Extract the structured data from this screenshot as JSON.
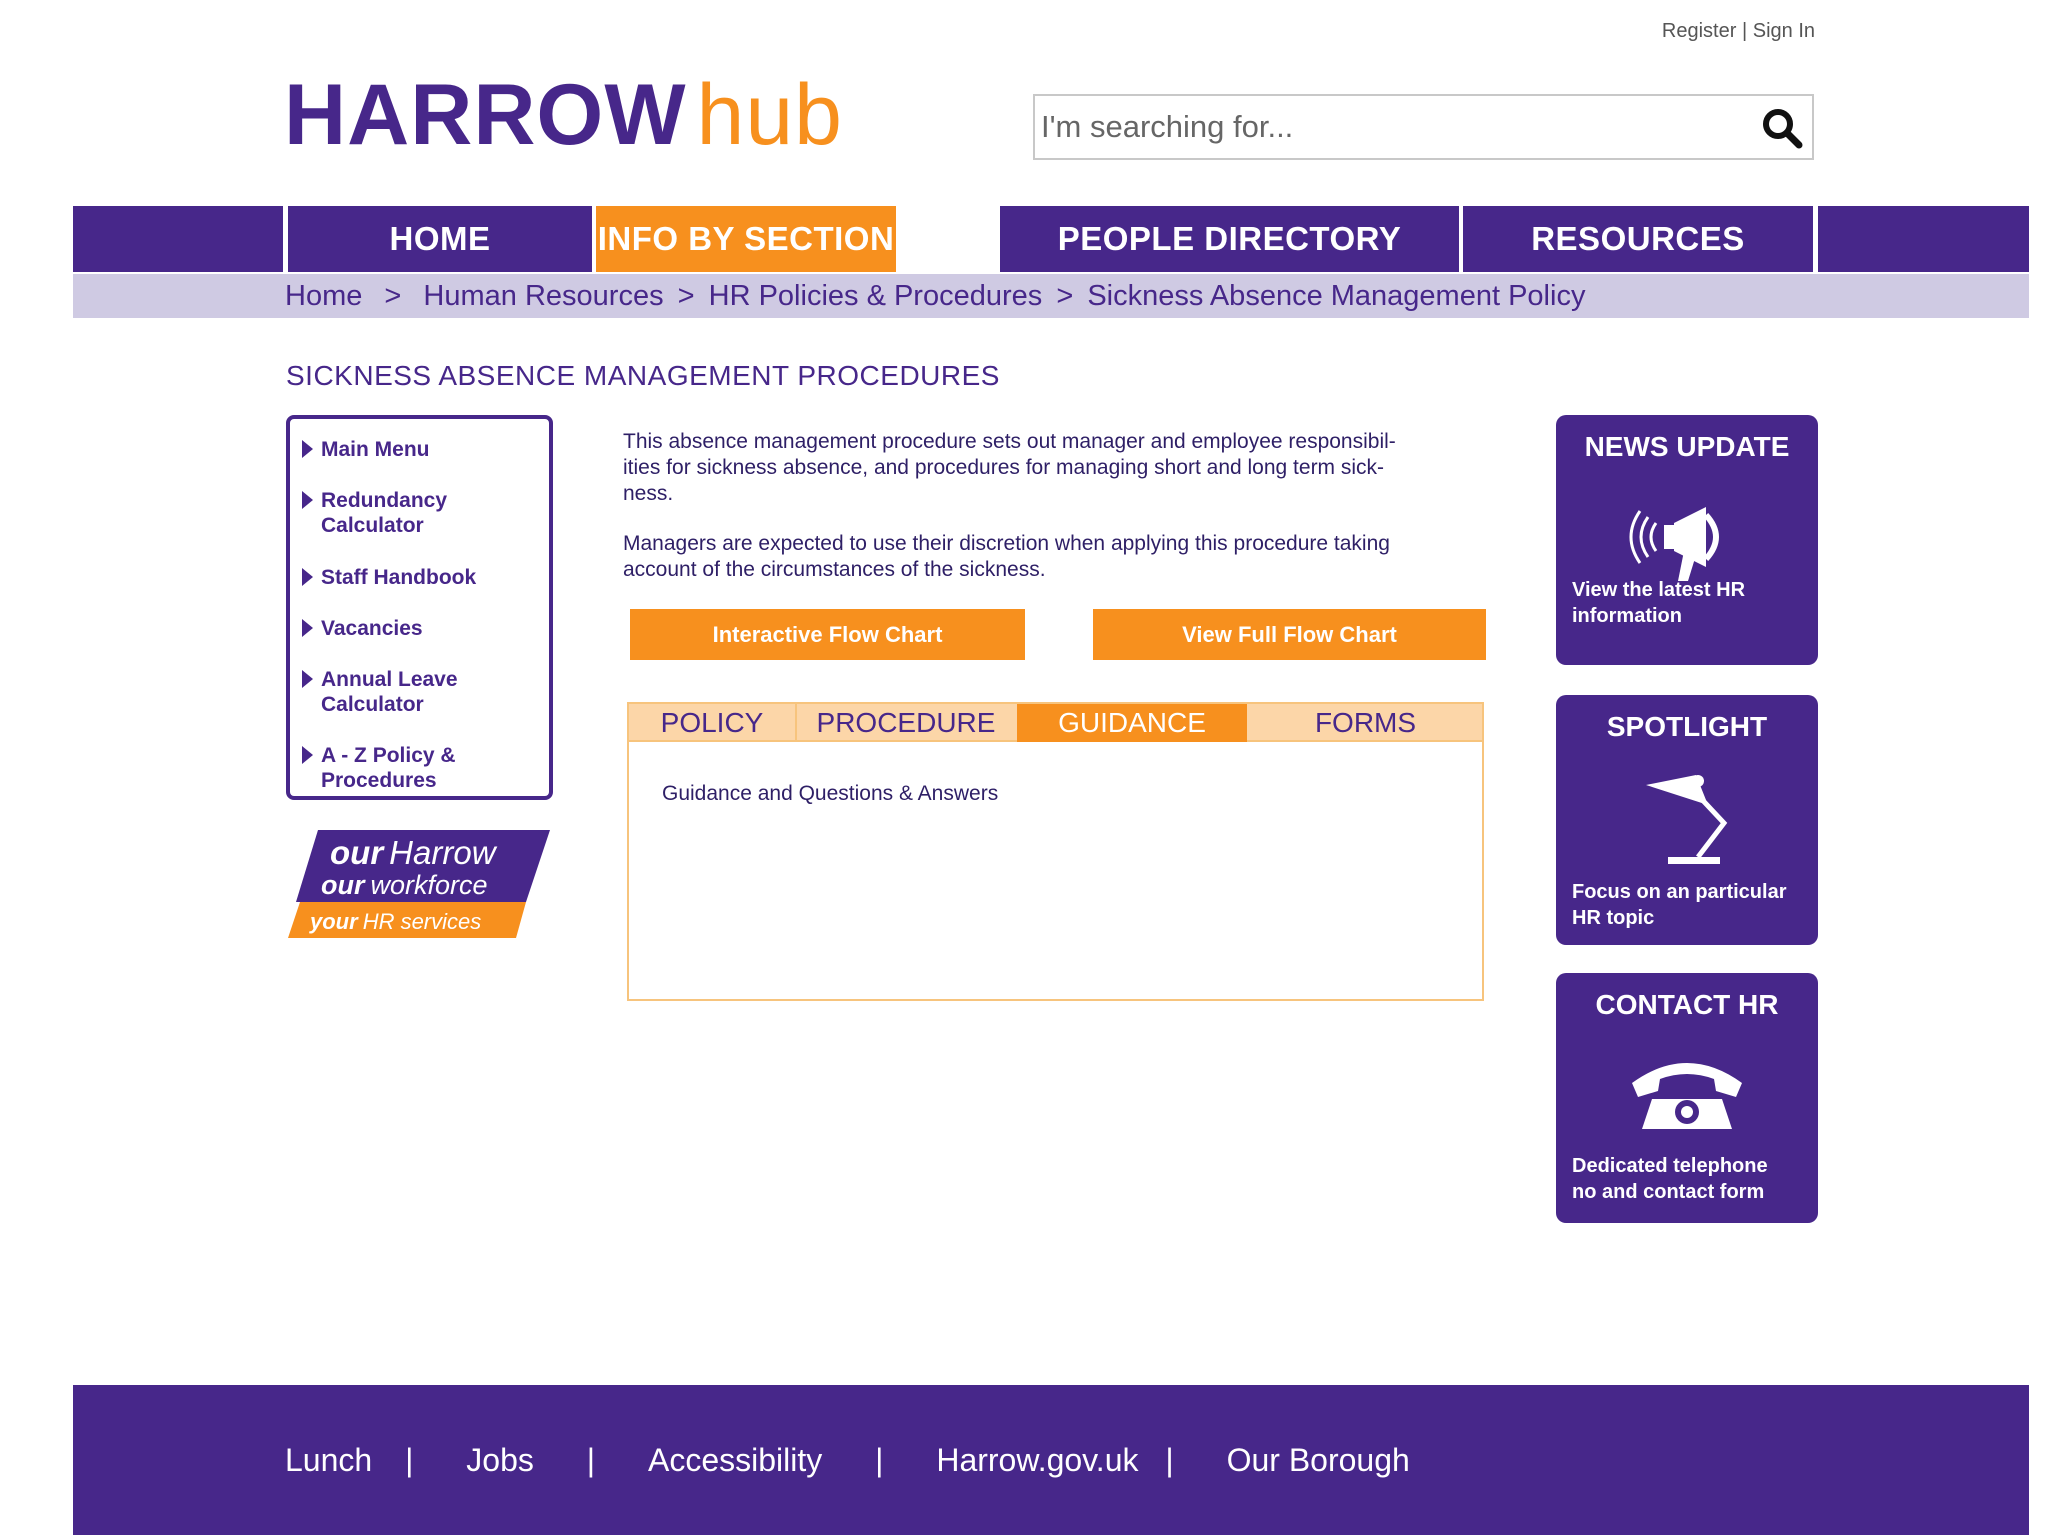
{
  "top_links": {
    "register": "Register",
    "separator": "|",
    "sign_in": "Sign In"
  },
  "logo": {
    "part1": "HARROW",
    "part2": "hub"
  },
  "search": {
    "placeholder": "I'm searching for..."
  },
  "nav": {
    "items": [
      {
        "label": "HOME"
      },
      {
        "label": "INFO BY SECTION",
        "active": true
      },
      {
        "label": "PEOPLE DIRECTORY"
      },
      {
        "label": "RESOURCES"
      }
    ]
  },
  "breadcrumb": {
    "items": [
      "Home",
      ">",
      "Human Resources",
      ">",
      "HR Policies & Procedures",
      ">",
      "Sickness Absence Management Policy"
    ]
  },
  "page_title": "SICKNESS ABSENCE MANAGEMENT PROCEDURES",
  "left_menu": {
    "items": [
      {
        "label": "Main Menu"
      },
      {
        "label": "Redundancy Calculator"
      },
      {
        "label": "Staff Handbook"
      },
      {
        "label": "Vacancies"
      },
      {
        "label": "Annual Leave Calculator"
      },
      {
        "label": "A - Z Policy & Procedures"
      }
    ]
  },
  "badge": {
    "line1_a": "our",
    "line1_b": "Harrow",
    "line2_a": "our",
    "line2_b": "workforce",
    "line3_a": "your",
    "line3_b": "HR services"
  },
  "content": {
    "para1": "This absence management procedure sets out manager and employee responsibil-ities for sickness absence, and procedures for managing short and long term sick-ness.",
    "para1_lines": [
      "This absence management procedure sets out manager and employee responsibil-",
      "ities for sickness absence, and procedures for managing short and long term sick-",
      "ness."
    ],
    "para2_lines": [
      "Managers are expected to use their discretion when applying this procedure taking",
      "account of the circumstances of the sickness."
    ],
    "button_interactive": "Interactive Flow Chart",
    "button_full": "View Full Flow Chart",
    "tabs": [
      {
        "label": "POLICY"
      },
      {
        "label": "PROCEDURE"
      },
      {
        "label": "GUIDANCE",
        "active": true
      },
      {
        "label": "FORMS"
      }
    ],
    "tab_content": "Guidance and Questions & Answers"
  },
  "right_boxes": [
    {
      "title": "NEWS UPDATE",
      "icon": "megaphone-icon",
      "desc_lines": [
        "View the latest HR",
        "information"
      ]
    },
    {
      "title": "SPOTLIGHT",
      "icon": "desk-lamp-icon",
      "desc_lines": [
        "Focus on an particular",
        "HR topic"
      ]
    },
    {
      "title": "CONTACT HR",
      "icon": "telephone-icon",
      "desc_lines": [
        "Dedicated telephone",
        "no and contact form"
      ]
    }
  ],
  "footer": {
    "links": [
      "Lunch",
      "Jobs",
      "Accessibility",
      "Harrow.gov.uk",
      "Our Borough"
    ],
    "separator": "|"
  },
  "colors": {
    "purple": "#47278a",
    "orange": "#f7901e",
    "breadcrumb_bg": "#cfcae3",
    "tab_bg": "#fcd6a8"
  }
}
